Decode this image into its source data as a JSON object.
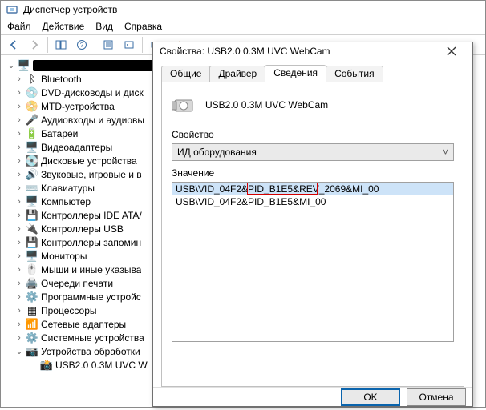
{
  "window": {
    "title": "Диспетчер устройств"
  },
  "menu": {
    "file": "Файл",
    "action": "Действие",
    "view": "Вид",
    "help": "Справка"
  },
  "tree": {
    "root": "█████████",
    "items": [
      "Bluetooth",
      "DVD-дисководы и диск",
      "MTD-устройства",
      "Аудиовходы и аудиовы",
      "Батареи",
      "Видеоадаптеры",
      "Дисковые устройства",
      "Звуковые, игровые и в",
      "Клавиатуры",
      "Компьютер",
      "Контроллеры IDE ATA/",
      "Контроллеры USB",
      "Контроллеры запомин",
      "Мониторы",
      "Мыши и иные указыва",
      "Очереди печати",
      "Программные устройс",
      "Процессоры",
      "Сетевые адаптеры",
      "Системные устройства"
    ],
    "open_group": "Устройства обработки",
    "open_child": "USB2.0 0.3M UVC W"
  },
  "dialog": {
    "title": "Свойства: USB2.0 0.3M UVC WebCam",
    "tabs": {
      "general": "Общие",
      "driver": "Драйвер",
      "details": "Сведения",
      "events": "События"
    },
    "device_name": "USB2.0 0.3M UVC WebCam",
    "property_label": "Свойство",
    "property_value": "ИД оборудования",
    "value_label": "Значение",
    "values": [
      "USB\\VID_04F2&PID_B1E5&REV_2069&MI_00",
      "USB\\VID_04F2&PID_B1E5&MI_00"
    ],
    "highlight_text": "&PID_B1E5&REV",
    "ok": "OK",
    "cancel": "Отмена"
  }
}
